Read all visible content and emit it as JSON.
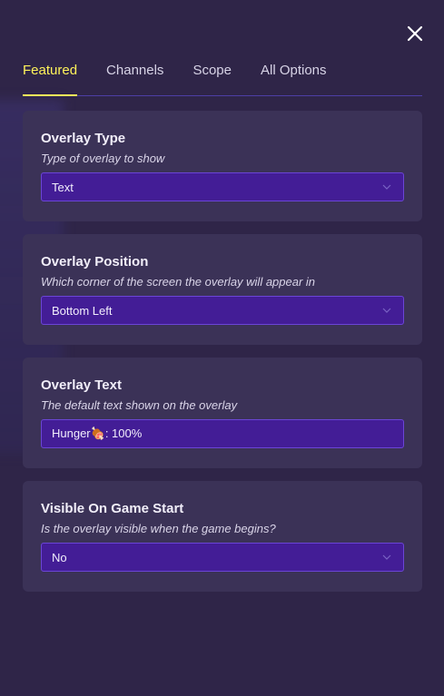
{
  "tabs": [
    "Featured",
    "Channels",
    "Scope",
    "All Options"
  ],
  "cards": [
    {
      "title": "Overlay Type",
      "description": "Type of overlay to show",
      "value": "Text"
    },
    {
      "title": "Overlay Position",
      "description": "Which corner of the screen the overlay will appear in",
      "value": "Bottom Left"
    },
    {
      "title": "Overlay Text",
      "description": "The default text shown on the overlay",
      "value": "Hunger🍖: 100%"
    },
    {
      "title": "Visible On Game Start",
      "description": "Is the overlay visible when the game begins?",
      "value": "No"
    }
  ],
  "colors": {
    "background": "#2f2548",
    "card": "#3b3257",
    "field": "#431d96",
    "active_tab": "#fff35a"
  },
  "icons": {
    "close": "close-icon",
    "dropdown": "chevron-down-icon"
  }
}
